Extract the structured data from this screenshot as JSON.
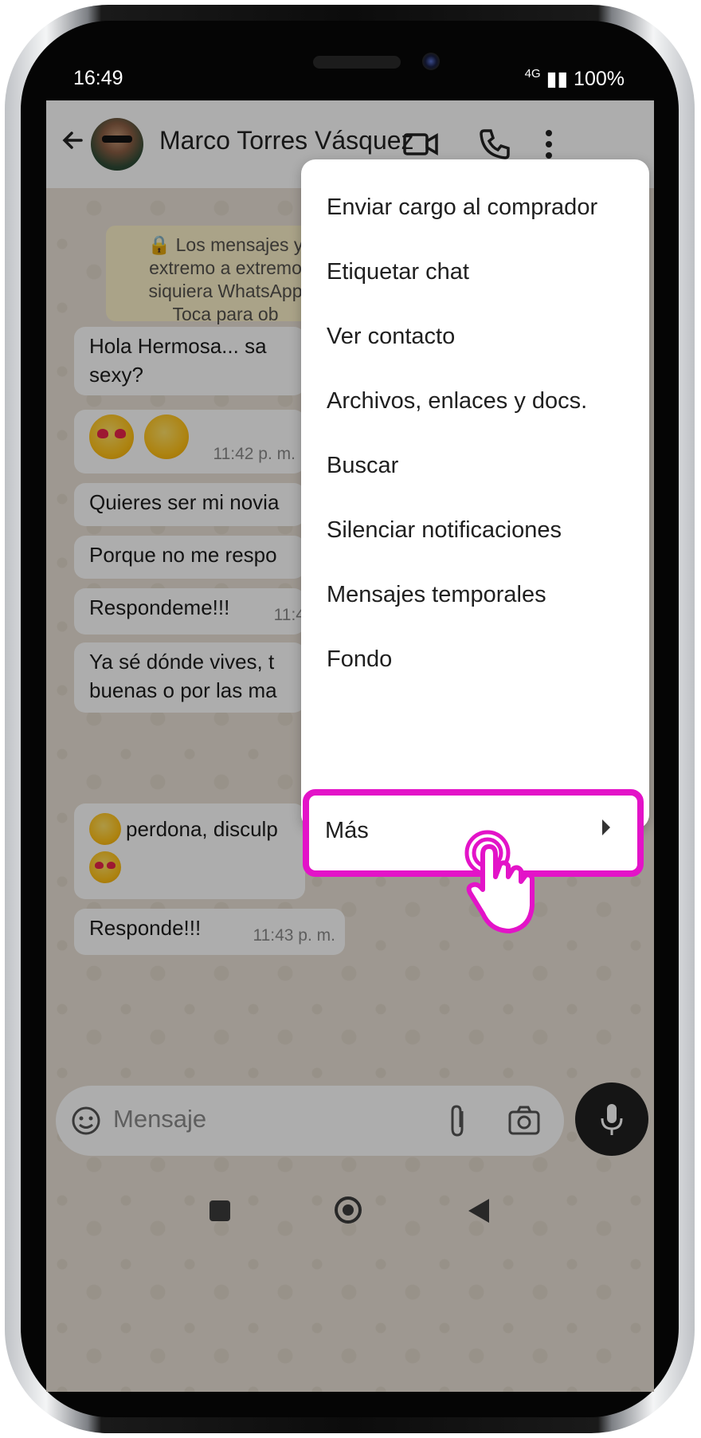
{
  "status": {
    "time": "16:49",
    "signal": "4G",
    "battery": "100%"
  },
  "chat": {
    "contact_name": "Marco Torres Vásquez",
    "system_message": "Los mensajes y las llamadas están cifrados de extremo a extremo. Nadie fuera de este chat, ni siquiera WhatsApp, puede leerlos ni escucharlos. Toca para obtener más información.",
    "system_visible": [
      "Los mensajes y",
      "extremo a extremo",
      "siquiera WhatsApp",
      "Toca para ob"
    ],
    "messages": [
      {
        "text_lines": [
          "Hola Hermosa... sa",
          "sexy?"
        ],
        "time": ""
      },
      {
        "emoji": [
          "heart-eyes",
          "kiss"
        ],
        "time": "11:42 p. m."
      },
      {
        "text_lines": [
          "Quieres ser mi novia"
        ],
        "time": ""
      },
      {
        "text_lines": [
          "Porque no me respo"
        ],
        "time": ""
      },
      {
        "text_lines": [
          "Respondeme!!!"
        ],
        "time": "11:4"
      },
      {
        "text_lines": [
          "Ya sé dónde vives, t",
          "buenas o por las ma"
        ],
        "time": ""
      },
      {
        "text_lines": [
          "perdona, disculp"
        ],
        "emoji": [
          "sad",
          "heart-eyes"
        ],
        "time": ""
      },
      {
        "text_lines": [
          "Responde!!!"
        ],
        "time": "11:43 p. m."
      }
    ]
  },
  "input": {
    "placeholder": "Mensaje"
  },
  "menu": {
    "items": [
      "Enviar cargo al comprador",
      "Etiquetar chat",
      "Ver contacto",
      "Archivos, enlaces y docs.",
      "Buscar",
      "Silenciar notificaciones",
      "Mensajes temporales",
      "Fondo"
    ],
    "highlighted": "Más"
  },
  "colors": {
    "highlight": "#e313c8",
    "menu_bg": "#ffffff",
    "overlay": "#000000"
  }
}
